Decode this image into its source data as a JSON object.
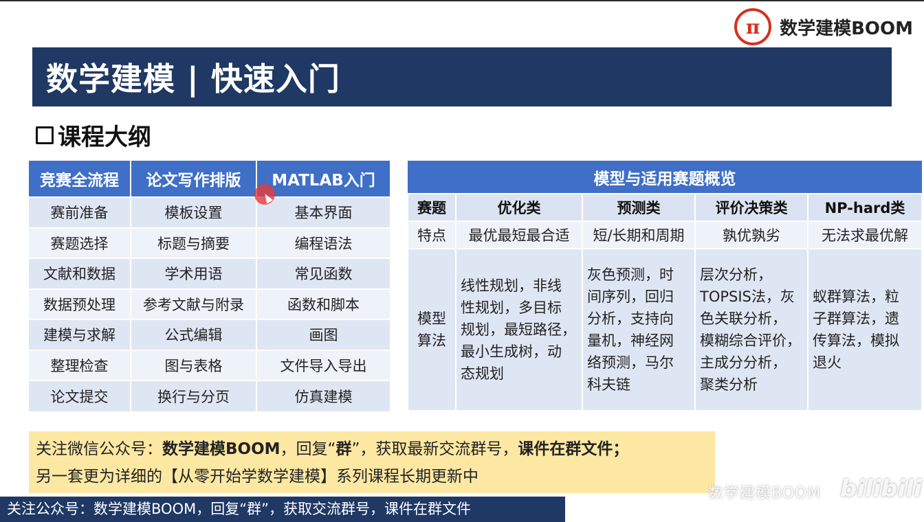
{
  "logo": {
    "symbol": "π",
    "text": "数学建模BOOM"
  },
  "banner": {
    "title": "数学建模 | 快速入门"
  },
  "section": {
    "title": "课程大纲"
  },
  "outline": {
    "headers": [
      "竞赛全流程",
      "论文写作排版",
      "MATLAB入门"
    ],
    "rows": [
      [
        "赛前准备",
        "模板设置",
        "基本界面"
      ],
      [
        "赛题选择",
        "标题与摘要",
        "编程语法"
      ],
      [
        "文献和数据",
        "学术用语",
        "常见函数"
      ],
      [
        "数据预处理",
        "参考文献与附录",
        "函数和脚本"
      ],
      [
        "建模与求解",
        "公式编辑",
        "画图"
      ],
      [
        "整理检查",
        "图与表格",
        "文件导入导出"
      ],
      [
        "论文提交",
        "换行与分页",
        "仿真建模"
      ]
    ]
  },
  "models": {
    "title": "模型与适用赛题概览",
    "columns": [
      "赛题",
      "优化类",
      "预测类",
      "评价决策类",
      "NP-hard类"
    ],
    "feature_row": [
      "特点",
      "最优最短最合适",
      "短/长期和周期",
      "孰优孰劣",
      "无法求最优解"
    ],
    "algo_row": [
      "模型\n算法",
      "线性规划，非线\n性规划，多目标\n规划，最短路径，\n最小生成树，动\n态规划",
      "灰色预测，时\n间序列，回归\n分析，支持向\n量机，神经网\n络预测，马尔\n科夫链",
      "层次分析，\nTOPSIS法，灰\n色关联分析，\n模糊综合评价，\n主成分分析，\n聚类分析",
      "蚁群算法，粒\n子群算法，遗\n传算法，模拟\n退火"
    ]
  },
  "notice": {
    "line1_a": "关注微信公众号：",
    "line1_b": "数学建模BOOM",
    "line1_c": "，回复“",
    "line1_d": "群",
    "line1_e": "”，获取最新交流群号，",
    "line1_f": "课件在群文件；",
    "line2": "另一套更为详细的【从零开始学数学建模】系列课程长期更新中"
  },
  "subtitle": "关注公众号：数学建模BOOM，回复“群”，获取交流群号，课件在群文件",
  "watermark": {
    "text": "数学建模BOOM",
    "platform": "bilibili"
  },
  "colors": {
    "banner": "#1f3864",
    "header_blue": "#3f6fc6",
    "notice_bg": "#fde8a3",
    "logo_red": "#d6301f"
  }
}
